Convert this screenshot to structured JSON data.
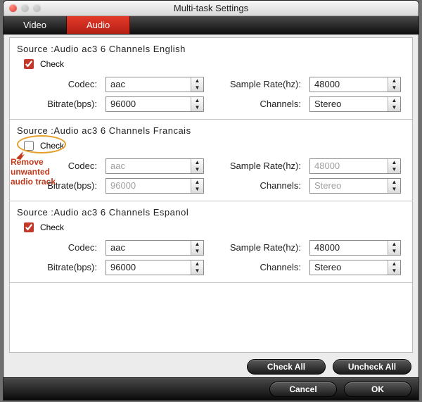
{
  "window": {
    "title": "Multi-task Settings"
  },
  "tabs": {
    "video": "Video",
    "audio": "Audio",
    "active": "audio"
  },
  "labels": {
    "check": "Check",
    "codec": "Codec:",
    "bitrate": "Bitrate(bps):",
    "samplerate": "Sample Rate(hz):",
    "channels": "Channels:"
  },
  "tracks": [
    {
      "source": "Source :Audio  ac3  6 Channels  English",
      "checked": true,
      "enabled": true,
      "codec": "aac",
      "bitrate": "96000",
      "samplerate": "48000",
      "channels": "Stereo"
    },
    {
      "source": "Source :Audio  ac3  6 Channels  Francais",
      "checked": false,
      "enabled": false,
      "codec": "aac",
      "bitrate": "96000",
      "samplerate": "48000",
      "channels": "Stereo"
    },
    {
      "source": "Source :Audio  ac3  6 Channels  Espanol",
      "checked": true,
      "enabled": true,
      "codec": "aac",
      "bitrate": "96000",
      "samplerate": "48000",
      "channels": "Stereo"
    }
  ],
  "buttons": {
    "check_all": "Check All",
    "uncheck_all": "Uncheck All",
    "cancel": "Cancel",
    "ok": "OK"
  },
  "annotation": "Remove unwanted audio track"
}
